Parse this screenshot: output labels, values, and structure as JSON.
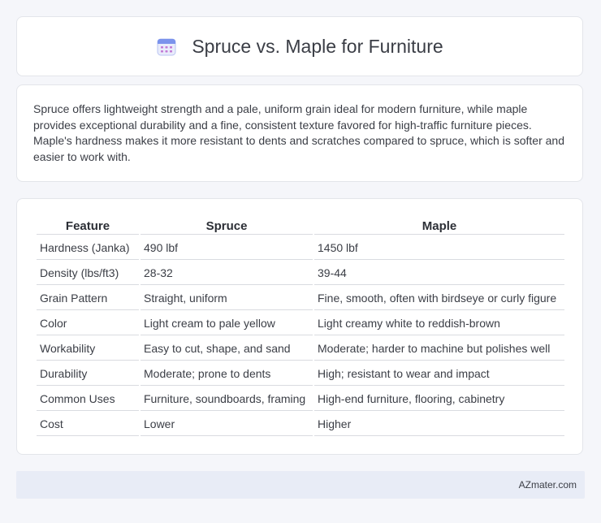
{
  "header": {
    "icon": "calendar-icon",
    "title": "Spruce vs. Maple for Furniture"
  },
  "summary": "Spruce offers lightweight strength and a pale, uniform grain ideal for modern furniture, while maple provides exceptional durability and a fine, consistent texture favored for high-traffic furniture pieces. Maple's hardness makes it more resistant to dents and scratches compared to spruce, which is softer and easier to work with.",
  "table": {
    "headers": [
      "Feature",
      "Spruce",
      "Maple"
    ],
    "rows": [
      [
        "Hardness (Janka)",
        "490 lbf",
        "1450 lbf"
      ],
      [
        "Density (lbs/ft3)",
        "28-32",
        "39-44"
      ],
      [
        "Grain Pattern",
        "Straight, uniform",
        "Fine, smooth, often with birdseye or curly figure"
      ],
      [
        "Color",
        "Light cream to pale yellow",
        "Light creamy white to reddish-brown"
      ],
      [
        "Workability",
        "Easy to cut, shape, and sand",
        "Moderate; harder to machine but polishes well"
      ],
      [
        "Durability",
        "Moderate; prone to dents",
        "High; resistant to wear and impact"
      ],
      [
        "Common Uses",
        "Furniture, soundboards, framing",
        "High-end furniture, flooring, cabinetry"
      ],
      [
        "Cost",
        "Lower",
        "Higher"
      ]
    ]
  },
  "footer": {
    "brand": "AZmater.com"
  }
}
